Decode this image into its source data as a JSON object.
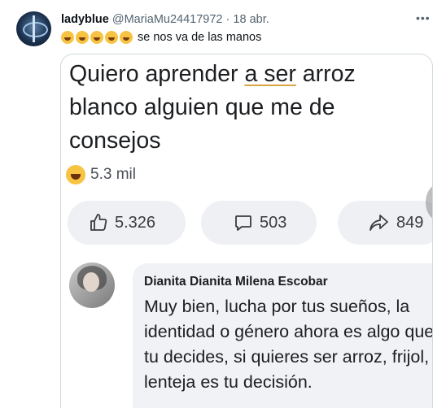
{
  "tweet": {
    "display_name": "ladyblue",
    "handle": "@MariaMu24417972",
    "separator": "·",
    "date": "18 abr.",
    "more_label": "•••",
    "emoji_count": 5,
    "text": "se nos va de las manos"
  },
  "media": {
    "post_text_before": "Quiero aprender ",
    "post_text_underlined": "a ser",
    "post_text_after": " arroz blanco alguien que me de consejos",
    "reaction_count": "5.3 mil",
    "like_count": "5.326",
    "comment_count": "503",
    "share_count": "849",
    "comment": {
      "author": "Dianita Dianita Milena Escobar",
      "text": "Muy bien, lucha por tus sueños, la identidad o género ahora es algo que tu decides, si quieres ser arroz, frijol, lenteja es tu decisión."
    }
  },
  "colors": {
    "underline": "#d9a441",
    "pill_bg": "#eef0f3",
    "bubble_bg": "#f0f2f5"
  }
}
